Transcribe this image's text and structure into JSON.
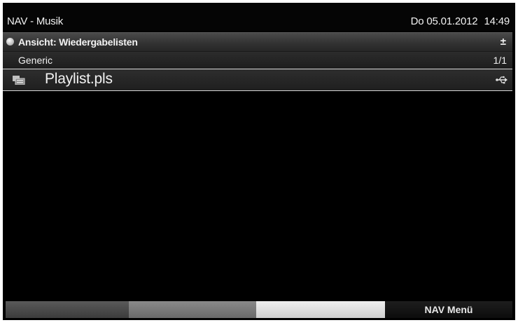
{
  "header": {
    "title": "NAV - Musik",
    "date": "Do 05.01.2012",
    "time": "14:49"
  },
  "view": {
    "label": "Ansicht: Wiedergabelisten",
    "toggle_glyph": "±"
  },
  "location": {
    "path": "Generic",
    "page_indicator": "1/1"
  },
  "files": [
    {
      "name": "Playlist.pls",
      "type_icon": "playlist-file-icon",
      "source_icon": "usb-icon"
    }
  ],
  "footer": {
    "color_keys": [
      "red",
      "green",
      "yellow",
      "blue"
    ],
    "blue_label": "NAV Menü"
  },
  "colors": {
    "background": "#000000",
    "text": "#f2f2f2",
    "selection_border": "#d9d9d9"
  }
}
